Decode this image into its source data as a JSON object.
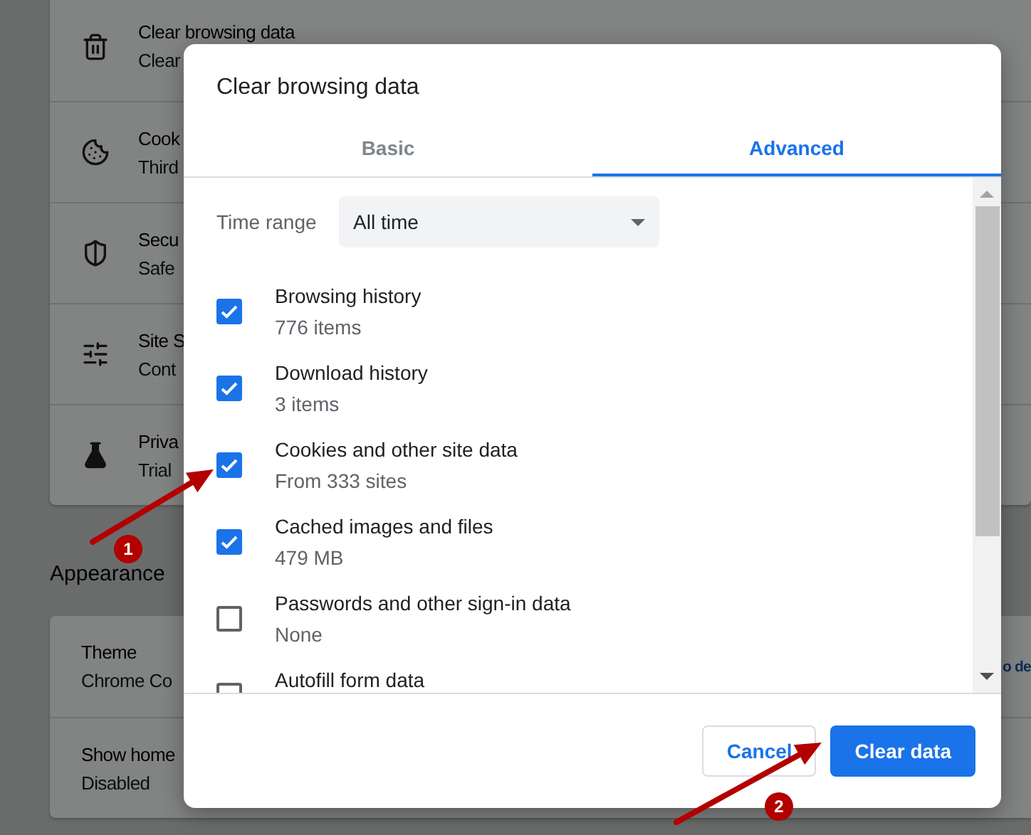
{
  "settings_page": {
    "privacy_rows": [
      {
        "title": "Clear browsing data",
        "subtitle": "Clear"
      },
      {
        "title": "Cook",
        "subtitle": "Third"
      },
      {
        "title": "Secu",
        "subtitle": "Safe"
      },
      {
        "title": "Site S",
        "subtitle": "Cont"
      },
      {
        "title": "Priva",
        "subtitle": "Trial"
      }
    ],
    "appearance_heading": "Appearance",
    "appearance_rows": [
      {
        "title": "Theme",
        "subtitle": "Chrome Co",
        "link": "o de"
      },
      {
        "title": "Show home",
        "subtitle": "Disabled"
      }
    ]
  },
  "dialog": {
    "title": "Clear browsing data",
    "tabs": [
      {
        "label": "Basic",
        "selected": false
      },
      {
        "label": "Advanced",
        "selected": true
      }
    ],
    "time_range": {
      "label": "Time range",
      "value": "All time"
    },
    "items": [
      {
        "label": "Browsing history",
        "detail": "776 items",
        "checked": true
      },
      {
        "label": "Download history",
        "detail": "3 items",
        "checked": true
      },
      {
        "label": "Cookies and other site data",
        "detail": "From 333 sites",
        "checked": true
      },
      {
        "label": "Cached images and files",
        "detail": "479 MB",
        "checked": true
      },
      {
        "label": "Passwords and other sign-in data",
        "detail": "None",
        "checked": false
      },
      {
        "label": "Autofill form data",
        "checked": false
      }
    ],
    "buttons": [
      {
        "label": "Cancel",
        "kind": "secondary"
      },
      {
        "label": "Clear data",
        "kind": "primary"
      }
    ]
  },
  "annotations": [
    {
      "number": "1"
    },
    {
      "number": "2"
    }
  ]
}
